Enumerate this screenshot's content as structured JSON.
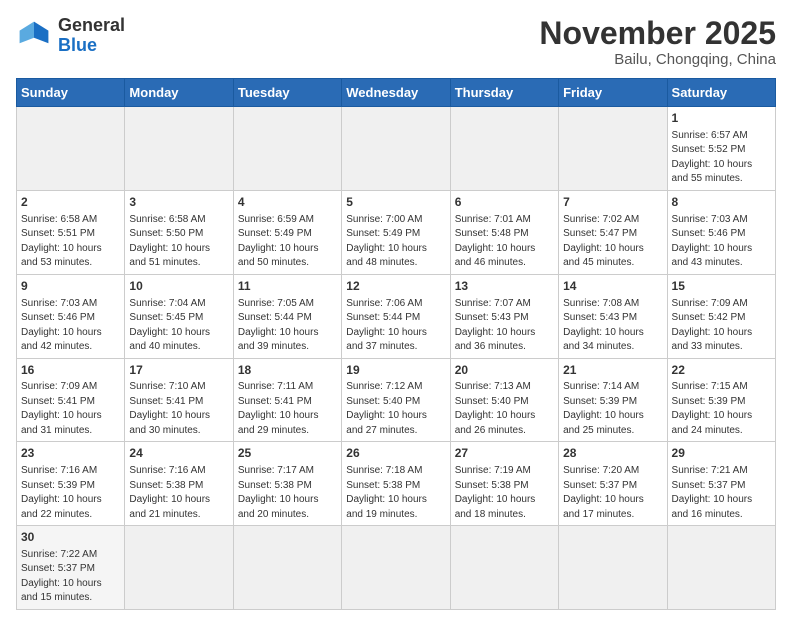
{
  "header": {
    "logo_general": "General",
    "logo_blue": "Blue",
    "main_title": "November 2025",
    "subtitle": "Bailu, Chongqing, China"
  },
  "weekdays": [
    "Sunday",
    "Monday",
    "Tuesday",
    "Wednesday",
    "Thursday",
    "Friday",
    "Saturday"
  ],
  "weeks": [
    [
      {
        "num": "",
        "info": "",
        "empty": true
      },
      {
        "num": "",
        "info": "",
        "empty": true
      },
      {
        "num": "",
        "info": "",
        "empty": true
      },
      {
        "num": "",
        "info": "",
        "empty": true
      },
      {
        "num": "",
        "info": "",
        "empty": true
      },
      {
        "num": "",
        "info": "",
        "empty": true
      },
      {
        "num": "1",
        "info": "Sunrise: 6:57 AM\nSunset: 5:52 PM\nDaylight: 10 hours\nand 55 minutes."
      }
    ],
    [
      {
        "num": "2",
        "info": "Sunrise: 6:58 AM\nSunset: 5:51 PM\nDaylight: 10 hours\nand 53 minutes."
      },
      {
        "num": "3",
        "info": "Sunrise: 6:58 AM\nSunset: 5:50 PM\nDaylight: 10 hours\nand 51 minutes."
      },
      {
        "num": "4",
        "info": "Sunrise: 6:59 AM\nSunset: 5:49 PM\nDaylight: 10 hours\nand 50 minutes."
      },
      {
        "num": "5",
        "info": "Sunrise: 7:00 AM\nSunset: 5:49 PM\nDaylight: 10 hours\nand 48 minutes."
      },
      {
        "num": "6",
        "info": "Sunrise: 7:01 AM\nSunset: 5:48 PM\nDaylight: 10 hours\nand 46 minutes."
      },
      {
        "num": "7",
        "info": "Sunrise: 7:02 AM\nSunset: 5:47 PM\nDaylight: 10 hours\nand 45 minutes."
      },
      {
        "num": "8",
        "info": "Sunrise: 7:03 AM\nSunset: 5:46 PM\nDaylight: 10 hours\nand 43 minutes."
      }
    ],
    [
      {
        "num": "9",
        "info": "Sunrise: 7:03 AM\nSunset: 5:46 PM\nDaylight: 10 hours\nand 42 minutes."
      },
      {
        "num": "10",
        "info": "Sunrise: 7:04 AM\nSunset: 5:45 PM\nDaylight: 10 hours\nand 40 minutes."
      },
      {
        "num": "11",
        "info": "Sunrise: 7:05 AM\nSunset: 5:44 PM\nDaylight: 10 hours\nand 39 minutes."
      },
      {
        "num": "12",
        "info": "Sunrise: 7:06 AM\nSunset: 5:44 PM\nDaylight: 10 hours\nand 37 minutes."
      },
      {
        "num": "13",
        "info": "Sunrise: 7:07 AM\nSunset: 5:43 PM\nDaylight: 10 hours\nand 36 minutes."
      },
      {
        "num": "14",
        "info": "Sunrise: 7:08 AM\nSunset: 5:43 PM\nDaylight: 10 hours\nand 34 minutes."
      },
      {
        "num": "15",
        "info": "Sunrise: 7:09 AM\nSunset: 5:42 PM\nDaylight: 10 hours\nand 33 minutes."
      }
    ],
    [
      {
        "num": "16",
        "info": "Sunrise: 7:09 AM\nSunset: 5:41 PM\nDaylight: 10 hours\nand 31 minutes."
      },
      {
        "num": "17",
        "info": "Sunrise: 7:10 AM\nSunset: 5:41 PM\nDaylight: 10 hours\nand 30 minutes."
      },
      {
        "num": "18",
        "info": "Sunrise: 7:11 AM\nSunset: 5:41 PM\nDaylight: 10 hours\nand 29 minutes."
      },
      {
        "num": "19",
        "info": "Sunrise: 7:12 AM\nSunset: 5:40 PM\nDaylight: 10 hours\nand 27 minutes."
      },
      {
        "num": "20",
        "info": "Sunrise: 7:13 AM\nSunset: 5:40 PM\nDaylight: 10 hours\nand 26 minutes."
      },
      {
        "num": "21",
        "info": "Sunrise: 7:14 AM\nSunset: 5:39 PM\nDaylight: 10 hours\nand 25 minutes."
      },
      {
        "num": "22",
        "info": "Sunrise: 7:15 AM\nSunset: 5:39 PM\nDaylight: 10 hours\nand 24 minutes."
      }
    ],
    [
      {
        "num": "23",
        "info": "Sunrise: 7:16 AM\nSunset: 5:39 PM\nDaylight: 10 hours\nand 22 minutes."
      },
      {
        "num": "24",
        "info": "Sunrise: 7:16 AM\nSunset: 5:38 PM\nDaylight: 10 hours\nand 21 minutes."
      },
      {
        "num": "25",
        "info": "Sunrise: 7:17 AM\nSunset: 5:38 PM\nDaylight: 10 hours\nand 20 minutes."
      },
      {
        "num": "26",
        "info": "Sunrise: 7:18 AM\nSunset: 5:38 PM\nDaylight: 10 hours\nand 19 minutes."
      },
      {
        "num": "27",
        "info": "Sunrise: 7:19 AM\nSunset: 5:38 PM\nDaylight: 10 hours\nand 18 minutes."
      },
      {
        "num": "28",
        "info": "Sunrise: 7:20 AM\nSunset: 5:37 PM\nDaylight: 10 hours\nand 17 minutes."
      },
      {
        "num": "29",
        "info": "Sunrise: 7:21 AM\nSunset: 5:37 PM\nDaylight: 10 hours\nand 16 minutes."
      }
    ],
    [
      {
        "num": "30",
        "info": "Sunrise: 7:22 AM\nSunset: 5:37 PM\nDaylight: 10 hours\nand 15 minutes.",
        "last": true
      },
      {
        "num": "",
        "info": "",
        "empty": true,
        "last": true
      },
      {
        "num": "",
        "info": "",
        "empty": true,
        "last": true
      },
      {
        "num": "",
        "info": "",
        "empty": true,
        "last": true
      },
      {
        "num": "",
        "info": "",
        "empty": true,
        "last": true
      },
      {
        "num": "",
        "info": "",
        "empty": true,
        "last": true
      },
      {
        "num": "",
        "info": "",
        "empty": true,
        "last": true
      }
    ]
  ]
}
